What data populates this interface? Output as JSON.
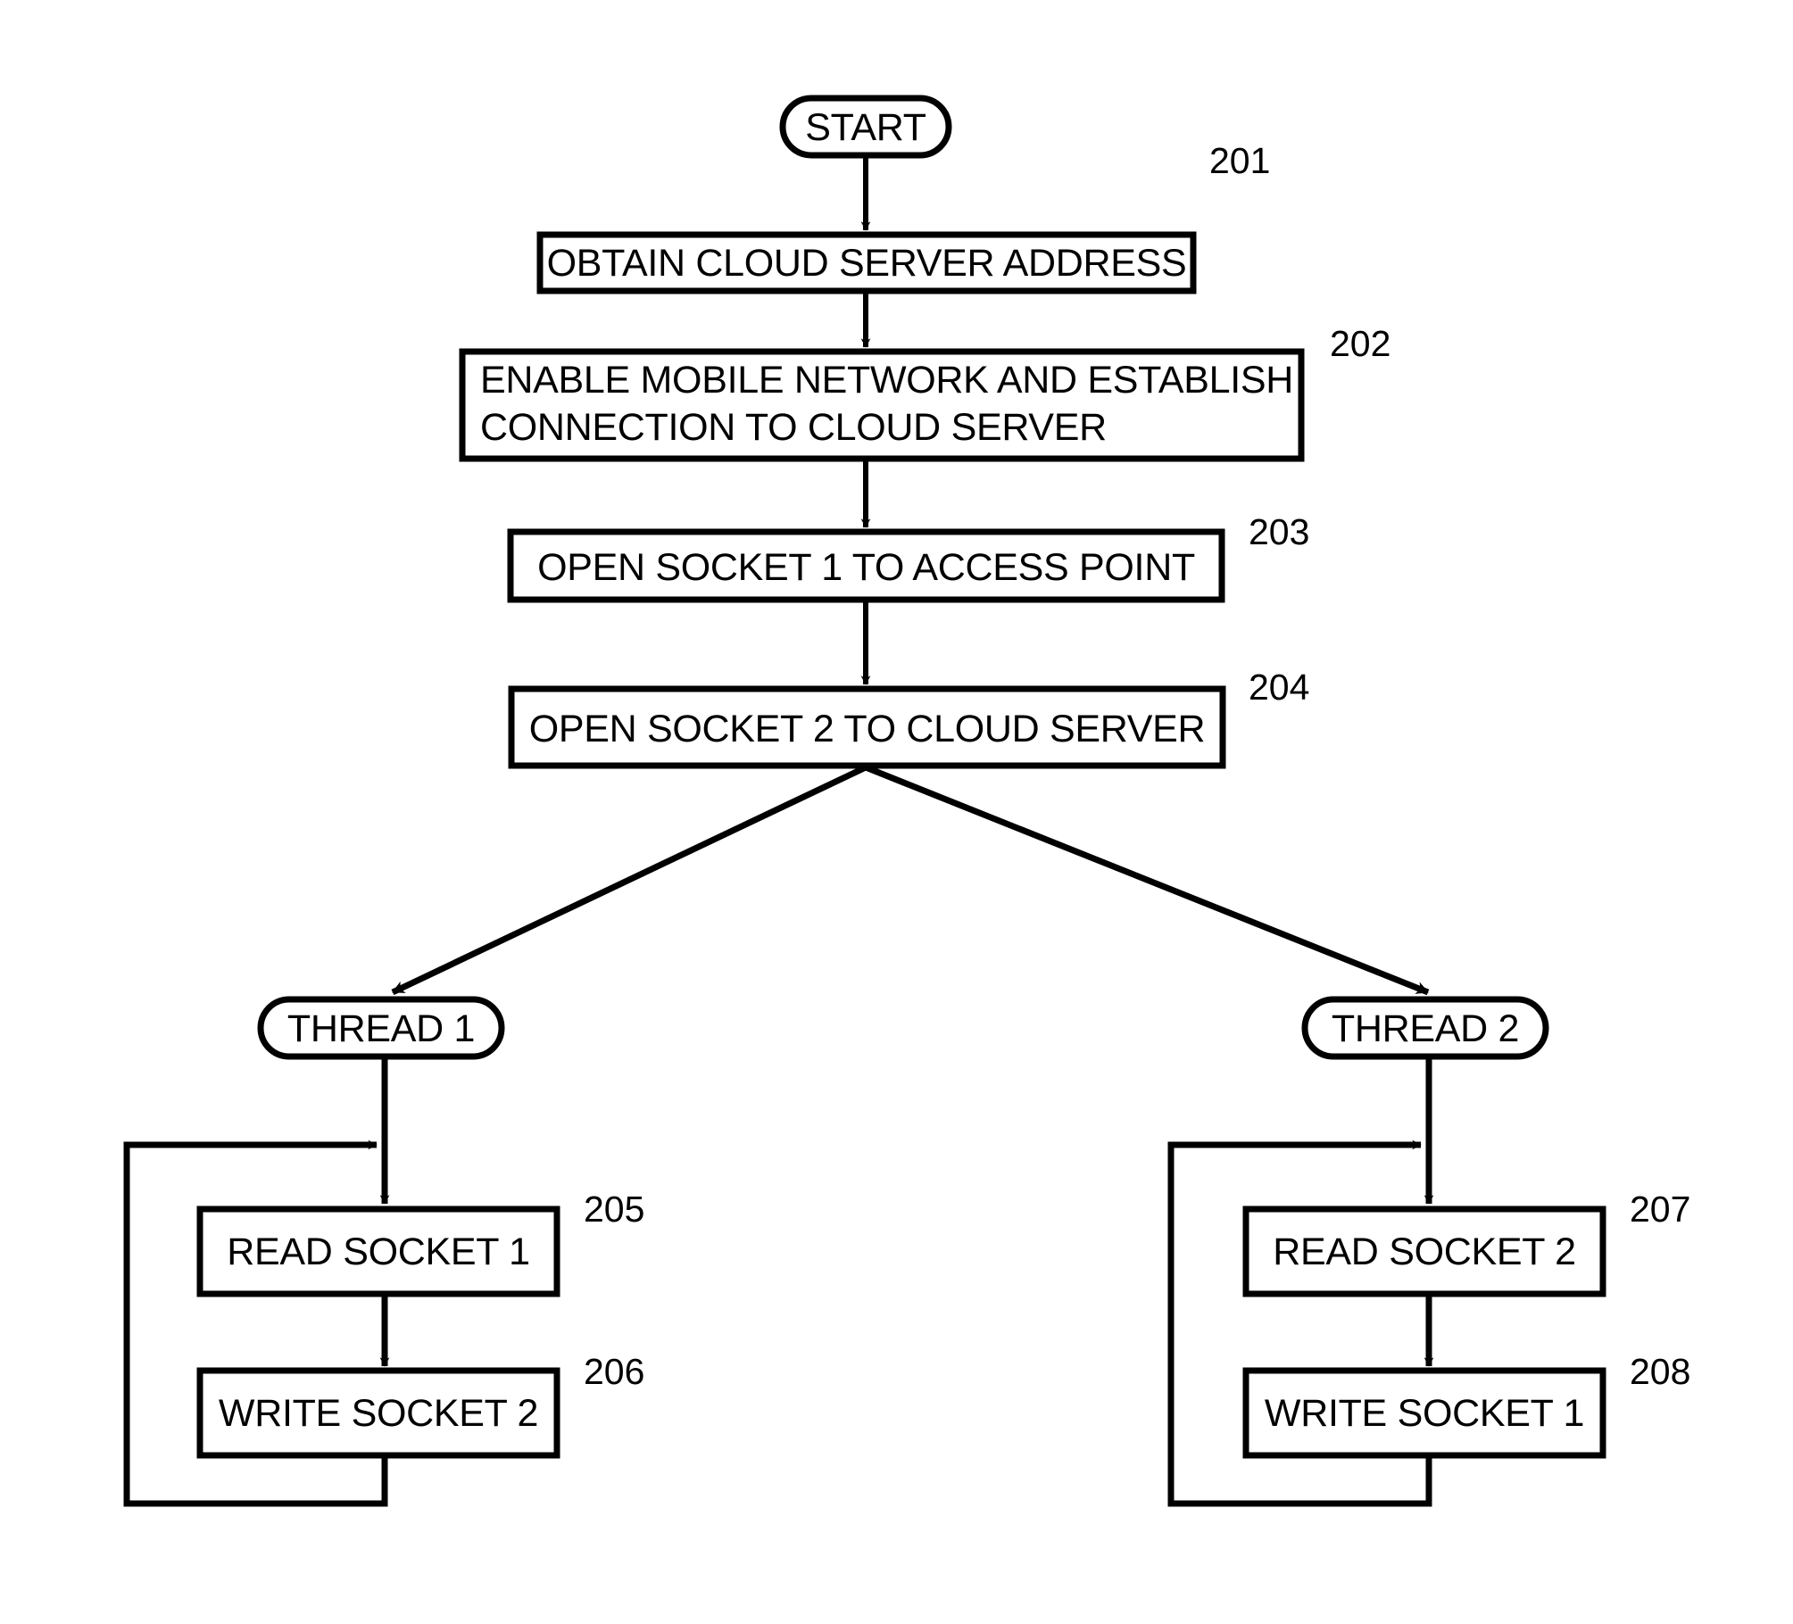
{
  "diagram": {
    "type": "flowchart",
    "title": "Cloud server socket relay process flowchart",
    "stroke_color": "#000000",
    "fill_color": "#ffffff",
    "background_color": "#ffffff",
    "nodes": {
      "start": {
        "label": "START",
        "shape": "terminator"
      },
      "n201": {
        "label": "OBTAIN CLOUD SERVER ADDRESS",
        "shape": "process",
        "ref": "201"
      },
      "n202_line1": {
        "label": "ENABLE MOBILE NETWORK AND ESTABLISH",
        "shape": "process",
        "ref": "202"
      },
      "n202_line2": {
        "label": "CONNECTION TO CLOUD SERVER"
      },
      "n203": {
        "label": "OPEN SOCKET 1 TO ACCESS POINT",
        "shape": "process",
        "ref": "203"
      },
      "n204": {
        "label": "OPEN SOCKET 2 TO CLOUD SERVER",
        "shape": "process",
        "ref": "204"
      },
      "thread1": {
        "label": "THREAD 1",
        "shape": "terminator"
      },
      "thread2": {
        "label": "THREAD 2",
        "shape": "terminator"
      },
      "n205": {
        "label": "READ SOCKET 1",
        "shape": "process",
        "ref": "205"
      },
      "n206": {
        "label": "WRITE SOCKET 2",
        "shape": "process",
        "ref": "206"
      },
      "n207": {
        "label": "READ SOCKET 2",
        "shape": "process",
        "ref": "207"
      },
      "n208": {
        "label": "WRITE SOCKET 1",
        "shape": "process",
        "ref": "208"
      }
    },
    "reference_numerals": {
      "r201": "201",
      "r202": "202",
      "r203": "203",
      "r204": "204",
      "r205": "205",
      "r206": "206",
      "r207": "207",
      "r208": "208"
    }
  }
}
